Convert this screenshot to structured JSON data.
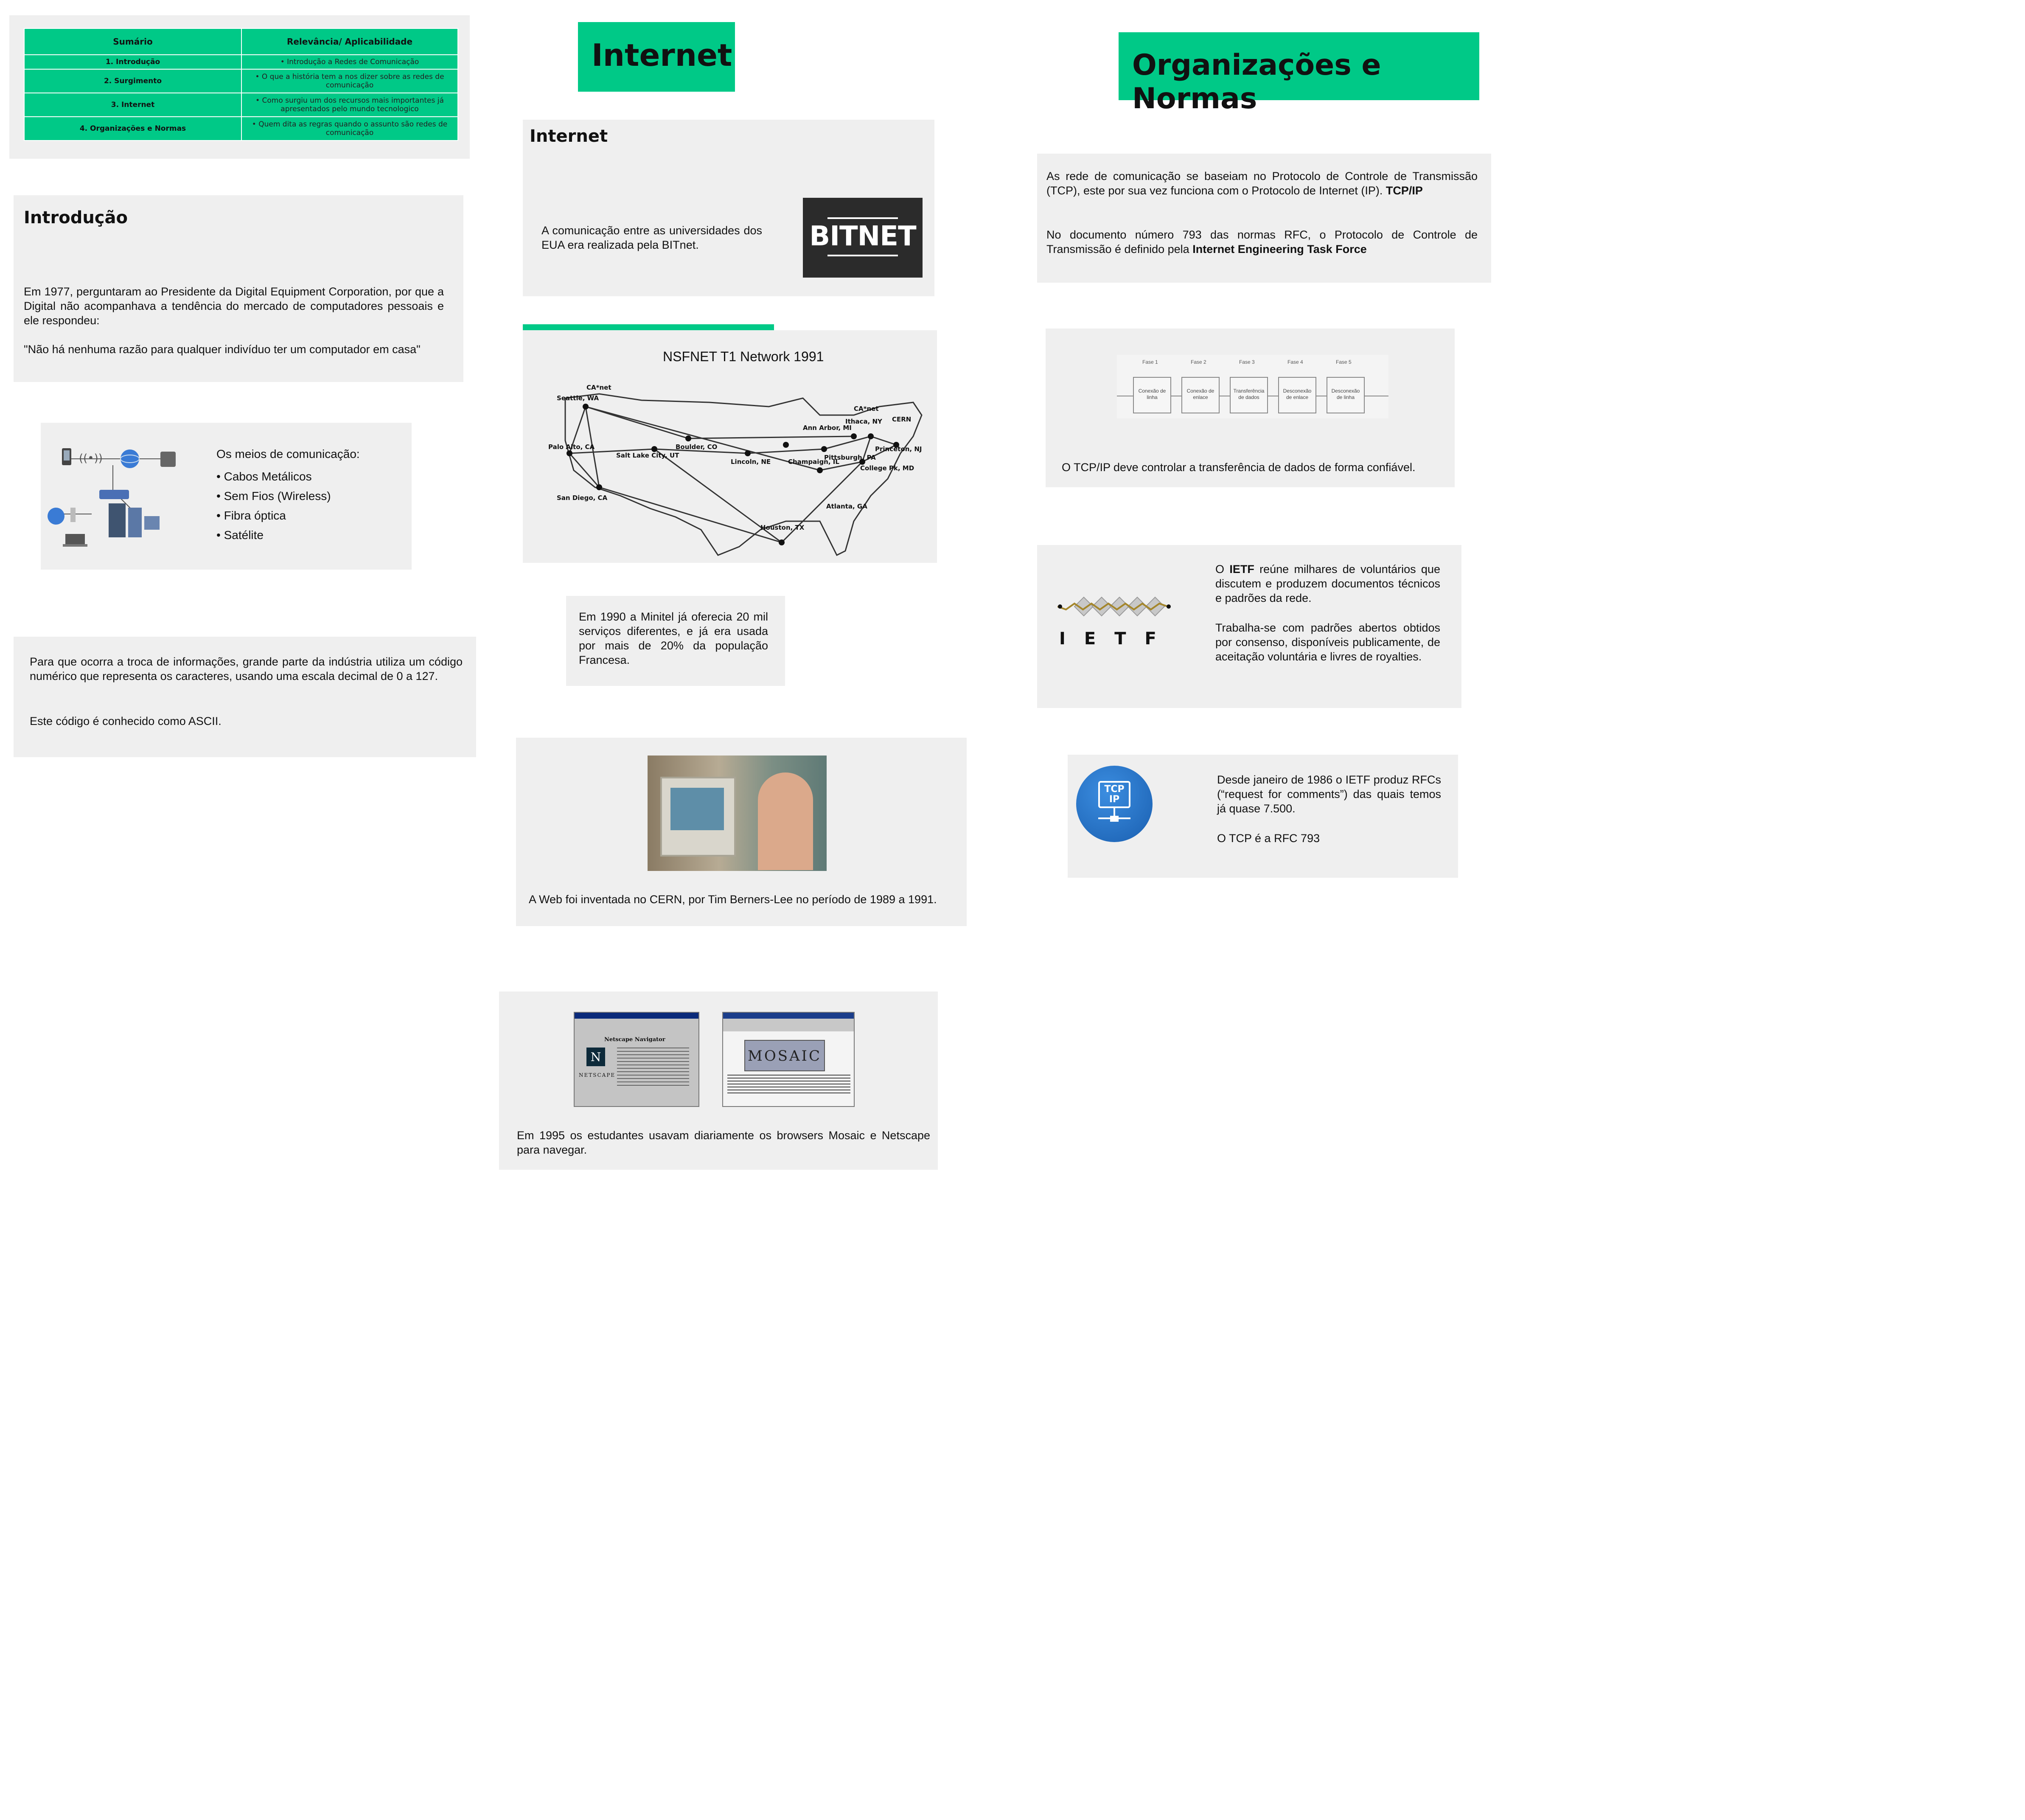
{
  "summary": {
    "headers": [
      "Sumário",
      "Relevância/ Aplicabilidade"
    ],
    "rows": [
      {
        "topic": "1. Introdução",
        "detail": "Introdução a Redes de Comunicação"
      },
      {
        "topic": "2. Surgimento",
        "detail": "O que a história tem a nos dizer sobre as redes de comunicação"
      },
      {
        "topic": "3. Internet",
        "detail": "Como surgiu um dos recursos mais importantes já apresentados pelo mundo tecnologico"
      },
      {
        "topic": "4. Organizações e Normas",
        "detail": "Quem dita as regras quando o assunto são redes de comunicação"
      }
    ]
  },
  "intro": {
    "title": "Introdução",
    "paragraph": "Em 1977, perguntaram ao Presidente da Digital Equipment Corporation, por que a Digital não acompanhava a tendência do mercado de computadores pessoais e ele respondeu:",
    "quote": "\"Não há nenhuma razão para qualquer indivíduo ter um computador em casa\""
  },
  "media": {
    "heading": "Os meios de comunicação:",
    "items": [
      "Cabos Metálicos",
      "Sem Fios (Wireless)",
      "Fibra óptica",
      "Satélite"
    ]
  },
  "ascii": {
    "paragraph": "Para que ocorra a troca de informações, grande parte da indústria utiliza um código numérico que representa os caracteres, usando uma escala decimal de 0 a 127.",
    "note": "Este código é conhecido como ASCII."
  },
  "internet_header": "Internet",
  "bitnet": {
    "title": "Internet",
    "text": "A comunicação entre as universidades dos EUA era realizada  pela BITnet.",
    "logo": "BITNET"
  },
  "nsfnet": {
    "title": "NSFNET T1 Network 1991",
    "nodes": [
      "CA*net",
      "Seattle, WA",
      "Palo Alto, CA",
      "San Diego, CA",
      "Salt Lake City, UT",
      "Boulder, CO",
      "Lincoln, NE",
      "Champaign, IL",
      "Ann Arbor, MI",
      "Ithaca, NY",
      "CA*net",
      "CERN",
      "Princeton, NJ",
      "Pittsburgh, PA",
      "College Pk, MD",
      "Atlanta, GA",
      "Houston, TX"
    ]
  },
  "minitel": {
    "text": "Em 1990 a Minitel já oferecia 20 mil serviços diferentes, e já era usada por mais de 20% da população Francesa."
  },
  "web": {
    "text": "A Web foi inventada no CERN, por  Tim Berners-Lee no período de 1989 a 1991."
  },
  "browsers": {
    "netscape_window_title": "Netscape Navigator",
    "netscape_brand": "NETSCAPE",
    "netscape_letter": "N",
    "mosaic_logo": "MOSAIC",
    "text": "Em 1995 os estudantes usavam diariamente os browsers Mosaic e Netscape para navegar."
  },
  "orgs_header": "Organizações e Normas",
  "tcp": {
    "paragraph": "As rede de comunicação se baseiam no Protocolo de Controle de Transmissão (TCP), este por sua vez funciona com o Protocolo de Internet (IP).",
    "bold": "TCP/IP",
    "paragraph2": "No documento número 793 das normas RFC, o Protocolo de Controle de Transmissão é definido pela",
    "bold2": "Internet Engineering Task Force"
  },
  "phases": {
    "labels": [
      "Fase 1",
      "Fase 2",
      "Fase 3",
      "Fase 4",
      "Fase 5"
    ],
    "boxes": [
      "Conexão de linha",
      "Conexão de enlace",
      "Transferência de dados",
      "Desconexão de enlace",
      "Desconexão de linha"
    ],
    "caption": "O TCP/IP deve controlar a transferência de dados de forma confiável."
  },
  "ietf": {
    "logo": "IETF",
    "p1_pre": "O",
    "p1_bold": "IETF",
    "p1_post": "reúne milhares de voluntários que discutem e produzem documentos técnicos e padrões da rede.",
    "p2": "Trabalha-se com padrões abertos obtidos por consenso, disponíveis publicamente, de aceitação voluntária e livres de royalties."
  },
  "rfc": {
    "icon_text": "TCP IP",
    "p1": "Desde janeiro de 1986 o IETF produz RFCs (“request for comments”) das quais temos já quase 7.500.",
    "p2": "O TCP é a RFC 793"
  },
  "colors": {
    "accent": "#00c987",
    "card": "#efefef"
  }
}
